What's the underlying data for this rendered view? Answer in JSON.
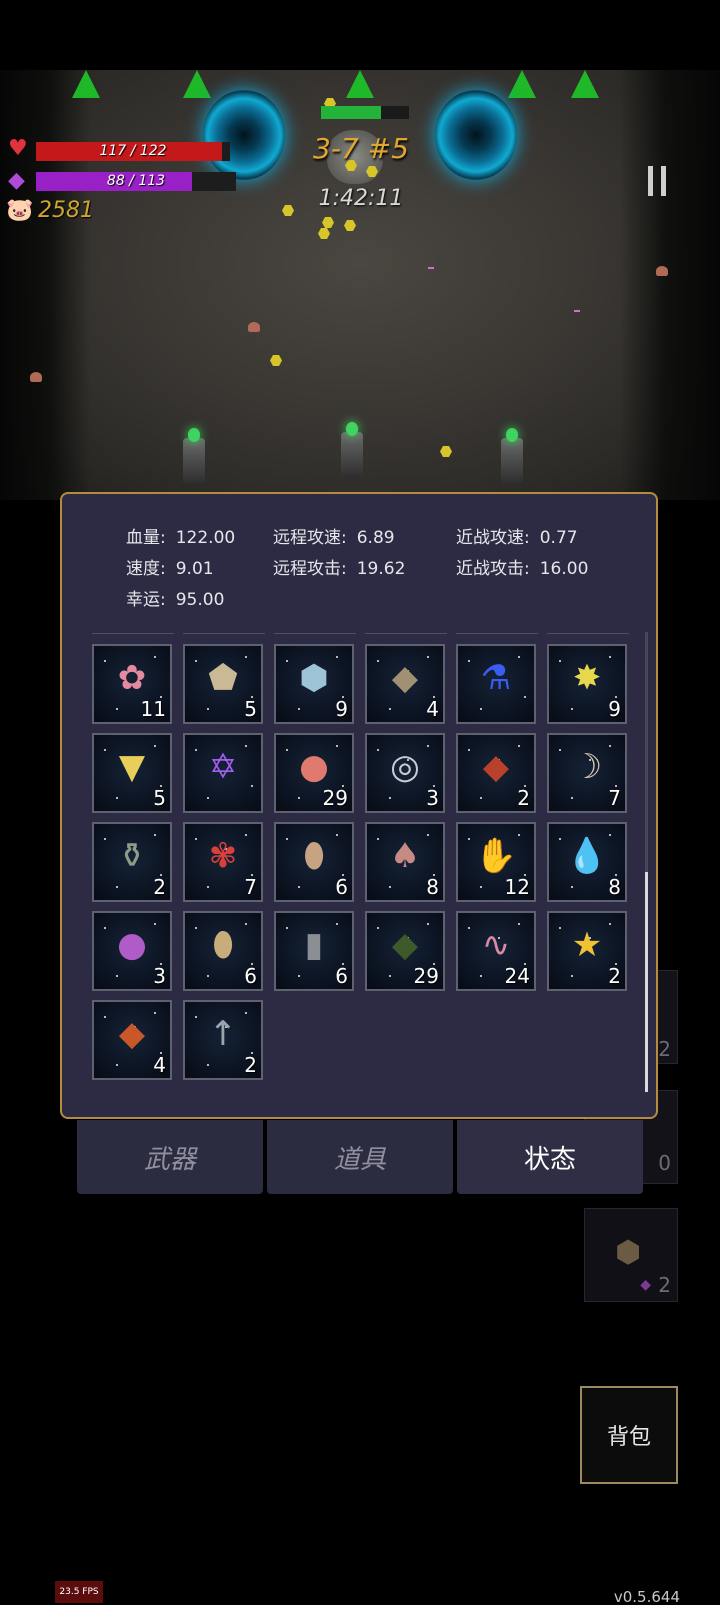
{
  "hud": {
    "hp_text": "117 / 122",
    "hp_fraction": 0.959,
    "mana_text": "88 / 113",
    "mana_fraction": 0.779,
    "gold": "2581",
    "stage": "3-7 #5",
    "timer": "1:42:11",
    "boss_health_fraction": 0.68,
    "colors": {
      "hp": "#c4191b",
      "mana": "#9820c6",
      "gold": "#d0a531",
      "stage": "#e0a632"
    },
    "icons": {
      "hp": "heart-icon",
      "mana": "diamond-icon",
      "gold": "pig-icon",
      "pause": "pause-icon"
    }
  },
  "stats": [
    {
      "label": "血量:",
      "value": "122.00"
    },
    {
      "label": "远程攻速:",
      "value": "6.89"
    },
    {
      "label": "近战攻速:",
      "value": "0.77"
    },
    {
      "label": "速度:",
      "value": "9.01"
    },
    {
      "label": "远程攻击:",
      "value": "19.62"
    },
    {
      "label": "近战攻击:",
      "value": "16.00"
    },
    {
      "label": "幸运:",
      "value": "95.00"
    }
  ],
  "items": [
    {
      "icon": "flower-garland-icon",
      "count": "11"
    },
    {
      "icon": "ore-chunks-icon",
      "count": "5"
    },
    {
      "icon": "crystal-rock-icon",
      "count": "9"
    },
    {
      "icon": "stones-icon",
      "count": "4"
    },
    {
      "icon": "blue-potion-icon",
      "count": ""
    },
    {
      "icon": "yellow-star-gem-icon",
      "count": "9"
    },
    {
      "icon": "yellow-card-icon",
      "count": "5"
    },
    {
      "icon": "purple-rune-icon",
      "count": ""
    },
    {
      "icon": "apple-icon",
      "count": "29"
    },
    {
      "icon": "silver-ring-icon",
      "count": "3"
    },
    {
      "icon": "red-book-icon",
      "count": "2"
    },
    {
      "icon": "horn-icon",
      "count": "7"
    },
    {
      "icon": "flask-icon",
      "count": "2"
    },
    {
      "icon": "red-flower-icon",
      "count": "7"
    },
    {
      "icon": "sack-icon",
      "count": "6"
    },
    {
      "icon": "mushroom-icon",
      "count": "8"
    },
    {
      "icon": "gloves-icon",
      "count": "12"
    },
    {
      "icon": "water-drop-icon",
      "count": "8"
    },
    {
      "icon": "slime-icon",
      "count": "3"
    },
    {
      "icon": "egg-icon",
      "count": "6"
    },
    {
      "icon": "tombstone-icon",
      "count": "6"
    },
    {
      "icon": "skull-book-icon",
      "count": "29"
    },
    {
      "icon": "worm-icon",
      "count": "24"
    },
    {
      "icon": "star-trophy-icon",
      "count": "2"
    },
    {
      "icon": "sun-book-icon",
      "count": "4"
    },
    {
      "icon": "arrow-icon",
      "count": "2"
    }
  ],
  "tabs": [
    {
      "label": "武器",
      "active": false
    },
    {
      "label": "道具",
      "active": false
    },
    {
      "label": "状态",
      "active": true
    }
  ],
  "side": {
    "counts": [
      "2",
      "0",
      "2"
    ]
  },
  "backpack_label": "背包",
  "fps": "23.5 FPS",
  "version": "v0.5.644"
}
